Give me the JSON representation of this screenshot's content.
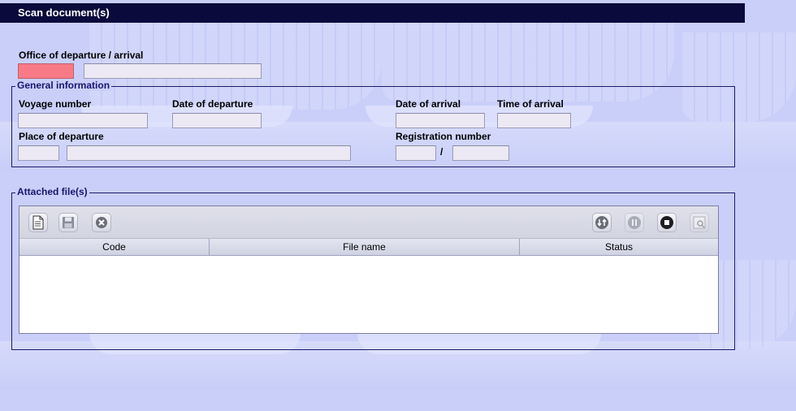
{
  "window": {
    "title": "Scan document(s)"
  },
  "office": {
    "label": "Office of departure / arrival",
    "code_value": "",
    "name_value": ""
  },
  "general": {
    "legend": "General information",
    "voyage_number": {
      "label": "Voyage number",
      "value": ""
    },
    "date_of_departure": {
      "label": "Date of departure",
      "value": ""
    },
    "date_of_arrival": {
      "label": "Date of arrival",
      "value": ""
    },
    "time_of_arrival": {
      "label": "Time of arrival",
      "value": ""
    },
    "place_of_departure": {
      "label": "Place of departure",
      "code_value": "",
      "name_value": ""
    },
    "registration_number": {
      "label": "Registration number",
      "part1": "",
      "separator": "/",
      "part2": ""
    }
  },
  "attached": {
    "legend": "Attached file(s)",
    "toolbar": {
      "left": [
        "new-document-icon",
        "save-icon",
        "delete-icon"
      ],
      "right": [
        "scan-icon",
        "pause-icon",
        "stop-icon",
        "preview-icon"
      ]
    },
    "columns": [
      "Code",
      "File name",
      "Status"
    ],
    "rows": []
  },
  "colors": {
    "titlebar": "#0a0a3c",
    "background": "#c9cff9",
    "required_field": "#f77a86",
    "group_border": "#1b1b6a"
  }
}
